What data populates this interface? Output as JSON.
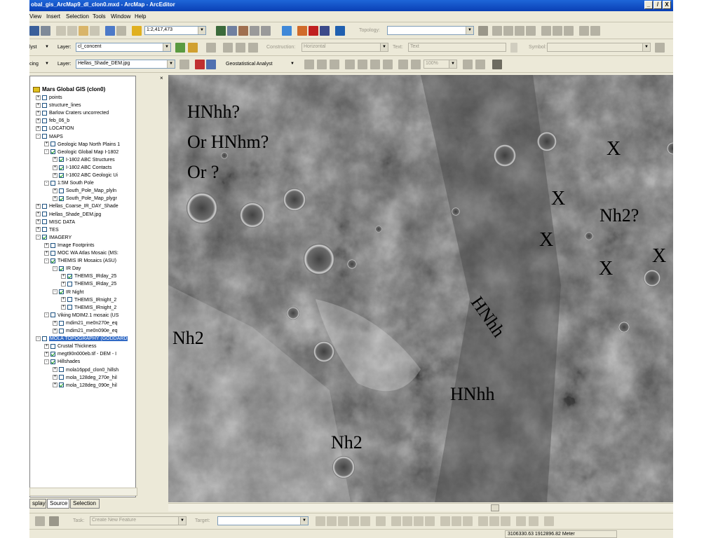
{
  "window": {
    "title": "obal_gis_ArcMap9_dl_clon0.mxd - ArcMap - ArcEditor",
    "controls": [
      "_",
      "̸",
      "X"
    ]
  },
  "menu": [
    "View",
    "Insert",
    "Selection",
    "Tools",
    "Window",
    "Help"
  ],
  "toolbar1": {
    "scale": "1:2,417,473",
    "topology_label": "Topology:"
  },
  "toolbar2": {
    "prefix": "lyst",
    "layer_label": "Layer:",
    "layer_value": "cl_concent",
    "construction_label": "Construction:",
    "construction_value": "Horizontal",
    "text_label": "Text:",
    "text_value": "Text",
    "symbol_label": "Symbol:"
  },
  "toolbar3": {
    "prefix": "cing",
    "layer_label": "Layer:",
    "layer_value": "Hellas_Shade_DEM.jpg",
    "geostat_label": "Geostatistical Analyst",
    "zoom_value": "100%"
  },
  "toc": {
    "root": "Mars Global GIS (clon0)",
    "items": [
      {
        "label": "points",
        "indent": 0,
        "exp": "+",
        "checked": false
      },
      {
        "label": "structure_lines",
        "indent": 0,
        "exp": "+",
        "checked": false
      },
      {
        "label": "Barlow Craters uncorrected",
        "indent": 0,
        "exp": "+",
        "checked": false
      },
      {
        "label": "feb_06_b",
        "indent": 0,
        "exp": "+",
        "checked": false
      },
      {
        "label": "LOCATION",
        "indent": 0,
        "exp": "+",
        "checked": false
      },
      {
        "label": "MAPS",
        "indent": 0,
        "exp": "-",
        "checked": false
      },
      {
        "label": "Geologic Map North Plains 1",
        "indent": 1,
        "exp": "+",
        "checked": false
      },
      {
        "label": "Geologic Global Map I-1802",
        "indent": 1,
        "exp": "-",
        "checked": true
      },
      {
        "label": "I-1802 ABC Structures",
        "indent": 2,
        "exp": "+",
        "checked": true
      },
      {
        "label": "I-1802 ABC Contacts",
        "indent": 2,
        "exp": "+",
        "checked": true
      },
      {
        "label": "I-1802 ABC Geologic Ui",
        "indent": 2,
        "exp": "+",
        "checked": true
      },
      {
        "label": "1:5M South Pole",
        "indent": 1,
        "exp": "-",
        "checked": false
      },
      {
        "label": "South_Pole_Map_plyln",
        "indent": 2,
        "exp": "+",
        "checked": false
      },
      {
        "label": "South_Pole_Map_plygr",
        "indent": 2,
        "exp": "+",
        "checked": true
      },
      {
        "label": "Hellas_Coarse_IR_DAY_Shade",
        "indent": 0,
        "exp": "+",
        "checked": false
      },
      {
        "label": "Hellas_Shade_DEM.jpg",
        "indent": 0,
        "exp": "+",
        "checked": false
      },
      {
        "label": "MISC DATA",
        "indent": 0,
        "exp": "+",
        "checked": false
      },
      {
        "label": "TES",
        "indent": 0,
        "exp": "+",
        "checked": false
      },
      {
        "label": "IMAGERY",
        "indent": 0,
        "exp": "-",
        "checked": true
      },
      {
        "label": "Image Footprints",
        "indent": 1,
        "exp": "+",
        "checked": false
      },
      {
        "label": "MOC WA Atlas Mosaic (MS:",
        "indent": 1,
        "exp": "+",
        "checked": false
      },
      {
        "label": "THEMIS IR Mosaics (ASU)",
        "indent": 1,
        "exp": "-",
        "checked": true
      },
      {
        "label": "IR Day",
        "indent": 2,
        "exp": "-",
        "checked": true
      },
      {
        "label": "THEMIS_IRday_25",
        "indent": 3,
        "exp": "+",
        "checked": true
      },
      {
        "label": "THEMIS_IRday_25",
        "indent": 3,
        "exp": "+",
        "checked": false
      },
      {
        "label": "IR Night",
        "indent": 2,
        "exp": "-",
        "checked": true
      },
      {
        "label": "THEMIS_IRnight_2",
        "indent": 3,
        "exp": "+",
        "checked": false
      },
      {
        "label": "THEMIS_IRnight_2",
        "indent": 3,
        "exp": "+",
        "checked": false
      },
      {
        "label": "Viking MDIM2.1 mosaic (US",
        "indent": 1,
        "exp": "-",
        "checked": false
      },
      {
        "label": "mdim21_me0n270e_eq",
        "indent": 2,
        "exp": "+",
        "checked": false
      },
      {
        "label": "mdim21_me0n090e_eq",
        "indent": 2,
        "exp": "+",
        "checked": false
      },
      {
        "label": "MOLA TOPOGRAPHY (GODDARD",
        "indent": 0,
        "exp": "-",
        "checked": false,
        "selected": true
      },
      {
        "label": "Crustal Thickness",
        "indent": 1,
        "exp": "+",
        "checked": false
      },
      {
        "label": "megt90n000eb.tif - DEM - I",
        "indent": 1,
        "exp": "+",
        "checked": true
      },
      {
        "label": "Hillshades",
        "indent": 1,
        "exp": "-",
        "checked": true
      },
      {
        "label": "mola16ppd_clon0_hillsh",
        "indent": 2,
        "exp": "+",
        "checked": false
      },
      {
        "label": "mola_128deg_270e_hil",
        "indent": 2,
        "exp": "+",
        "checked": false
      },
      {
        "label": "mola_128deg_090e_hil",
        "indent": 2,
        "exp": "+",
        "checked": true
      }
    ],
    "tabs": [
      "splay",
      "Source",
      "Selection"
    ]
  },
  "map_annotations": [
    {
      "text": "HNhh?",
      "size": 26
    },
    {
      "text": "Or HNhm?",
      "size": 26
    },
    {
      "text": "Or ?",
      "size": 26
    },
    {
      "text": "X",
      "size": 28
    },
    {
      "text": "X",
      "size": 28
    },
    {
      "text": "Nh2?",
      "size": 26
    },
    {
      "text": "X",
      "size": 28
    },
    {
      "text": "X",
      "size": 28
    },
    {
      "text": "X",
      "size": 28
    },
    {
      "text": "HNhh",
      "size": 26
    },
    {
      "text": "Nh2",
      "size": 26
    },
    {
      "text": "HNhh",
      "size": 26
    },
    {
      "text": "Nh2",
      "size": 26
    }
  ],
  "drawbar": {
    "task_label": "Task:",
    "task_value": "Create New Feature",
    "target_label": "Target:"
  },
  "status": {
    "coords": "3106330.63  1912896.82 Meter"
  },
  "colors": {
    "titlebar": "#0a3fb5",
    "chrome": "#ece9d8",
    "selection": "#316ac5"
  }
}
